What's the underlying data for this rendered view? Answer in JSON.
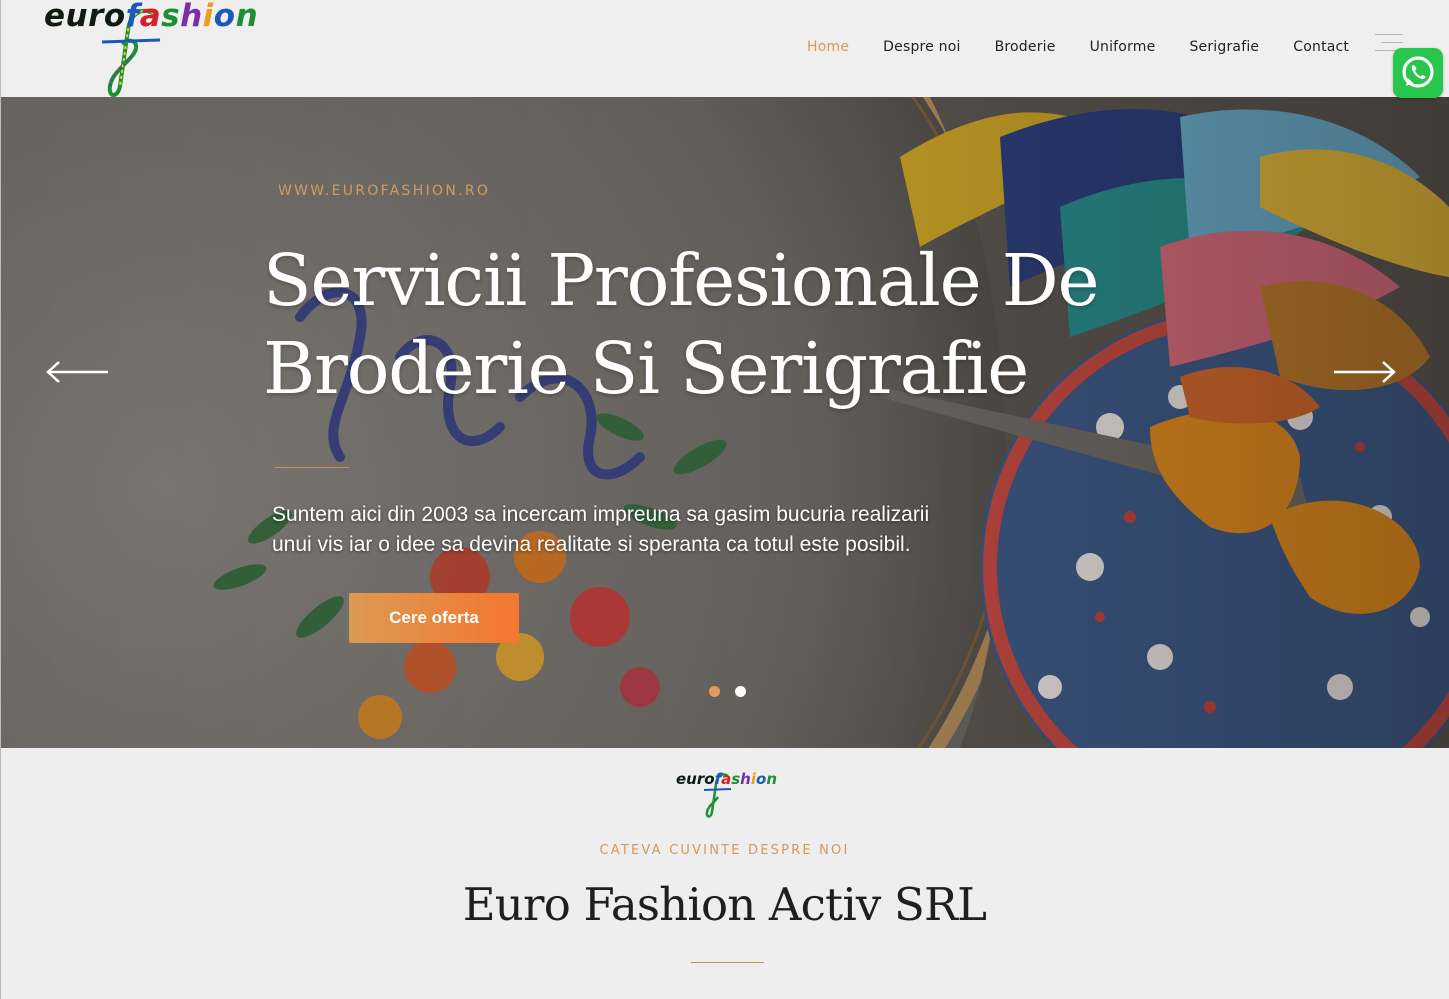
{
  "header": {
    "logo_parts": [
      "euro",
      "f",
      "a",
      "s",
      "h",
      "i",
      "o",
      "n"
    ],
    "nav": [
      "Home",
      "Despre noi",
      "Broderie",
      "Uniforme",
      "Serigrafie",
      "Contact"
    ],
    "active_nav": "Home",
    "menu_icon": "hamburger-menu-icon",
    "whatsapp_icon": "whatsapp-icon"
  },
  "hero": {
    "eyebrow": "WWW.EUROFASHION.RO",
    "headline_line1": "Servicii Profesionale De",
    "headline_line2": "Broderie Si Serigrafie",
    "tagline_line1": "Suntem aici din 2003 sa incercam impreuna sa gasim bucuria realizarii",
    "tagline_line2": "unui vis iar o idee sa devina realitate si speranta ca totul este posibil.",
    "cta": "Cere oferta",
    "prev_icon": "arrow-left-icon",
    "next_icon": "arrow-right-icon",
    "slides_total": 2,
    "active_slide": 1
  },
  "about": {
    "logo_parts": [
      "euro",
      "f",
      "a",
      "s",
      "h",
      "i",
      "o",
      "n"
    ],
    "eyebrow": "CATEVA CUVINTE DESPRE NOI",
    "title": "Euro Fashion Activ SRL"
  },
  "colors": {
    "accent": "#d29a5e",
    "nav_active": "#e0964f",
    "cta_start": "#dc9a52",
    "cta_end": "#f4762f",
    "whatsapp": "#27c64d",
    "page_bg": "#eeeeee",
    "text_dark": "#1f1f1f"
  }
}
